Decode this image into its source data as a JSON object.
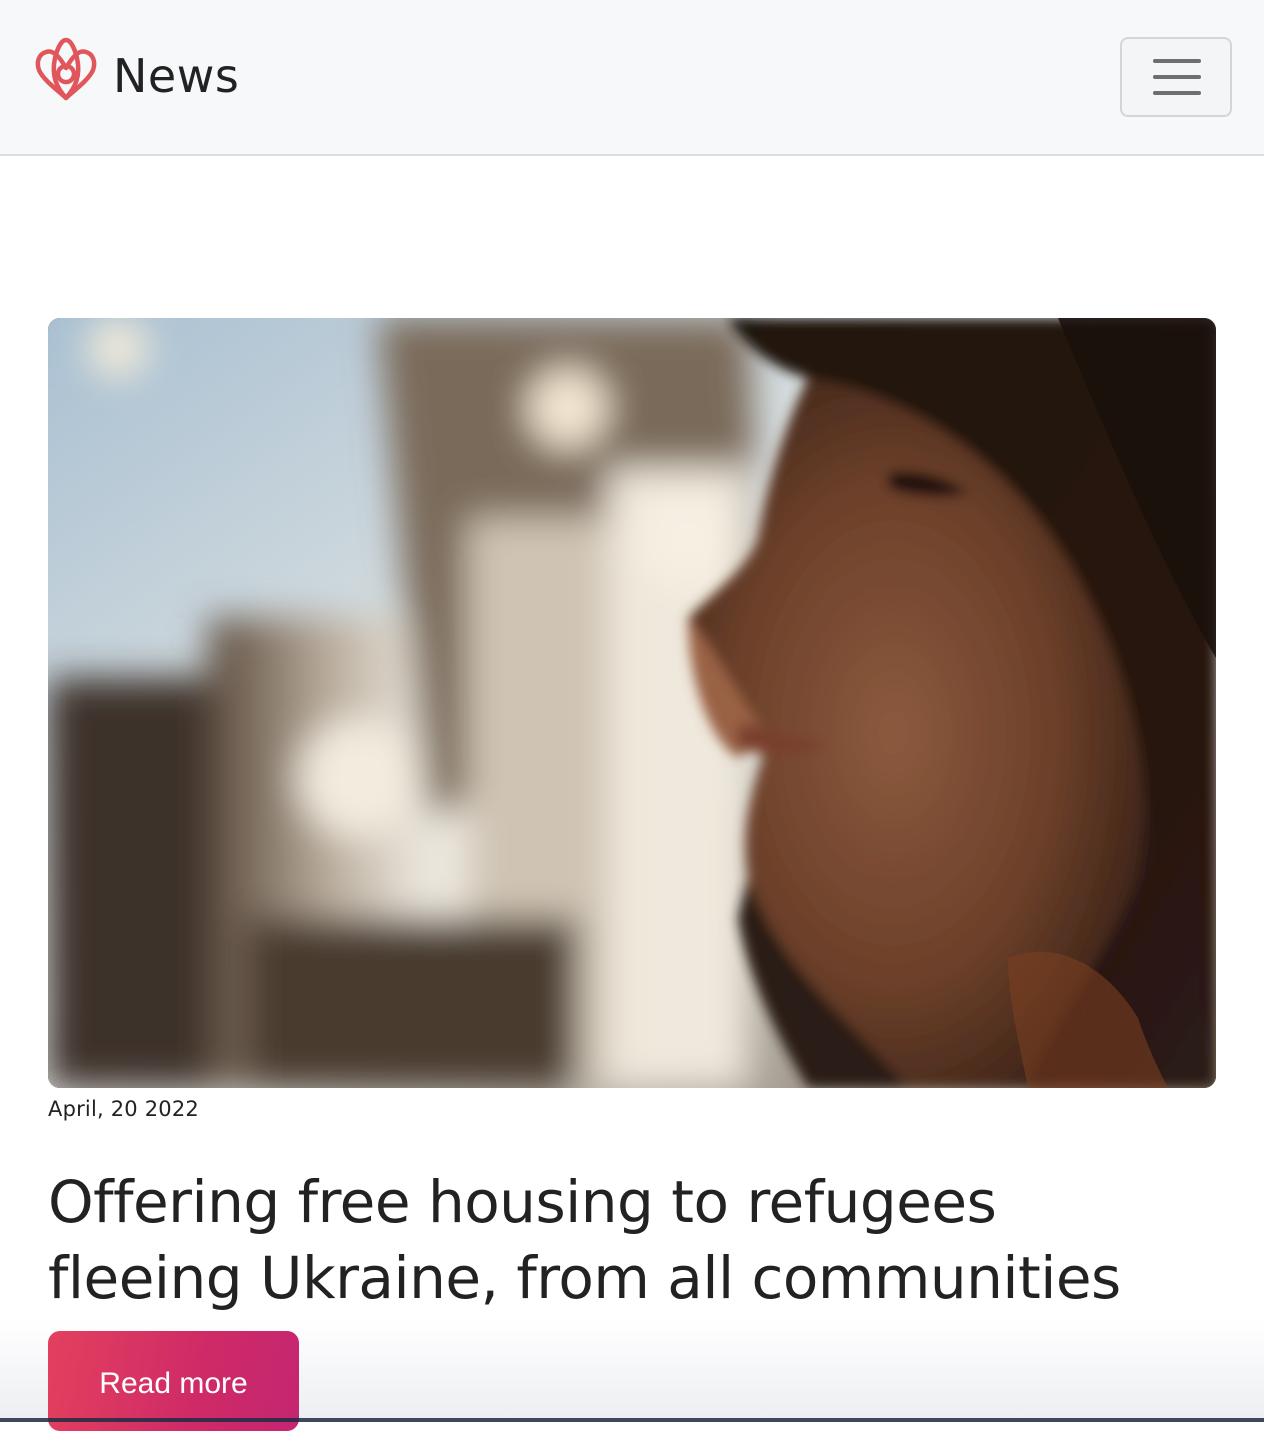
{
  "header": {
    "brand_name": "News",
    "logo_icon": "airbnb-belo-icon",
    "menu_icon": "hamburger-menu-icon",
    "accent_color": "#e0565b"
  },
  "article": {
    "image_description_icon": "hero-photo",
    "date": "April, 20 2022",
    "headline": "Offering free housing to refugees fleeing Ukraine, from all communities",
    "read_more_label": "Read more",
    "button_colors": [
      "#e3405e",
      "#c42670"
    ]
  }
}
